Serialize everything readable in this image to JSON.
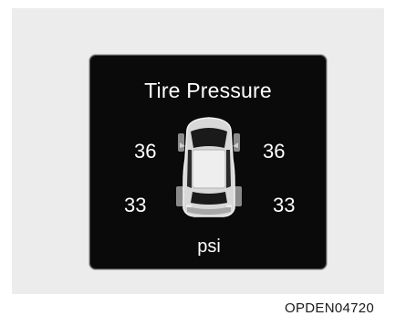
{
  "display": {
    "title": "Tire Pressure",
    "unit": "psi"
  },
  "tires": {
    "front_left": "36",
    "front_right": "36",
    "rear_left": "33",
    "rear_right": "33"
  },
  "reference_code": "OPDEN04720",
  "icons": {
    "vehicle": "car-top-view-icon"
  },
  "colors": {
    "panel_background": "#ececec",
    "display_background": "#0a0a0a",
    "display_text": "#ffffff"
  }
}
